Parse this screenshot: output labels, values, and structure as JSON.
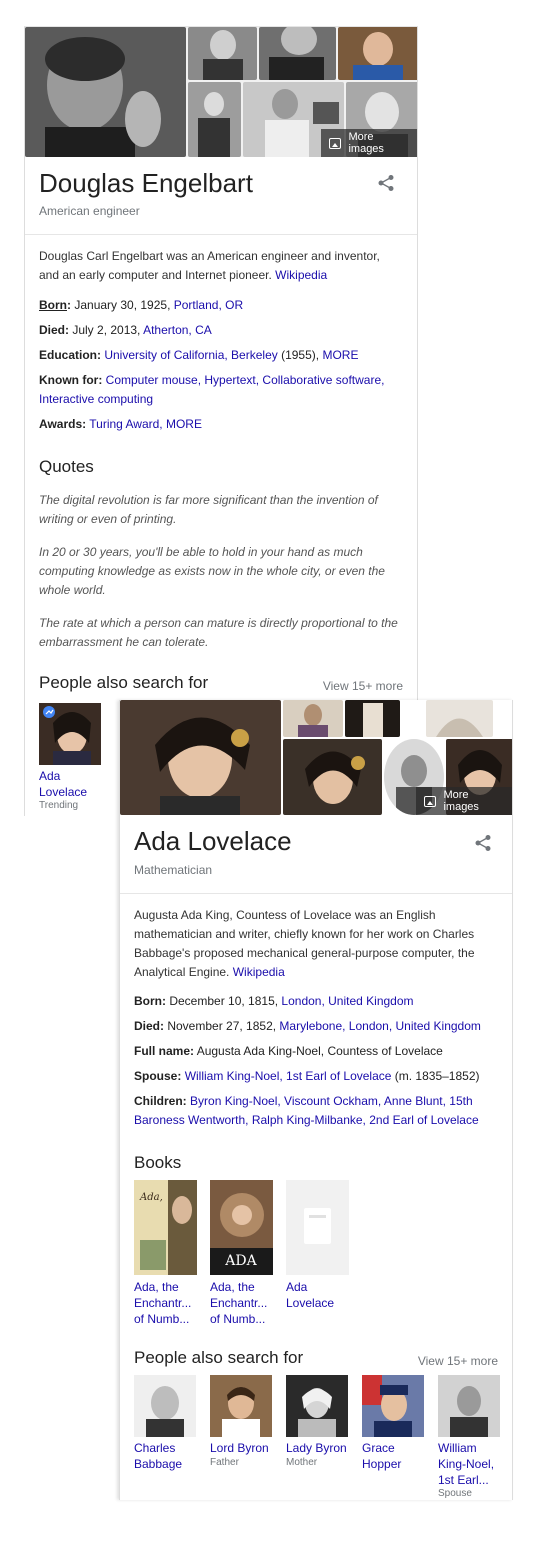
{
  "card1": {
    "more_images": "More images",
    "title": "Douglas Engelbart",
    "subtitle": "American engineer",
    "description": "Douglas Carl Engelbart was an American engineer and inventor, and an early computer and Internet pioneer.",
    "wiki": "Wikipedia",
    "born": {
      "label": "Born",
      "text": "January 30, 1925, ",
      "link": "Portland, OR"
    },
    "died": {
      "label": "Died:",
      "text": "July 2, 2013, ",
      "link": "Atherton, CA"
    },
    "education": {
      "label": "Education:",
      "link1": "University of California, Berkeley",
      "text": " (1955), ",
      "link2": "MORE"
    },
    "known_for": {
      "label": "Known for:",
      "links": "Computer mouse, Hypertext, Collaborative software, Interactive computing"
    },
    "awards": {
      "label": "Awards:",
      "links": "Turing Award, MORE"
    },
    "quotes_heading": "Quotes",
    "quotes": [
      "The digital revolution is far more significant than the invention of writing or even of printing.",
      "In 20 or 30 years, you'll be able to hold in your hand as much computing knowledge as exists now in the whole city, or even the whole world.",
      "The rate at which a person can mature is directly proportional to the embarrassment he can tolerate."
    ],
    "people_heading": "People also search for",
    "view_more": "View 15+ more",
    "people": [
      {
        "name": "Ada Lovelace",
        "sub": "Trending"
      }
    ]
  },
  "card2": {
    "more_images": "More images",
    "title": "Ada Lovelace",
    "subtitle": "Mathematician",
    "description": "Augusta Ada King, Countess of Lovelace was an English mathematician and writer, chiefly known for her work on Charles Babbage's proposed mechanical general-purpose computer, the Analytical Engine.",
    "wiki": "Wikipedia",
    "born": {
      "label": "Born:",
      "text": "December 10, 1815, ",
      "link": "London, United Kingdom"
    },
    "died": {
      "label": "Died:",
      "text": "November 27, 1852, ",
      "link": "Marylebone, London, United Kingdom"
    },
    "full_name": {
      "label": "Full name:",
      "text": "Augusta Ada King-Noel, Countess of Lovelace"
    },
    "spouse": {
      "label": "Spouse:",
      "link": "William King-Noel, 1st Earl of Lovelace",
      "text": " (m. 1835–1852)"
    },
    "children": {
      "label": "Children:",
      "links": "Byron King-Noel, Viscount Ockham, Anne Blunt, 15th Baroness Wentworth, Ralph King-Milbanke, 2nd Earl of Lovelace"
    },
    "books_heading": "Books",
    "books": [
      {
        "title": "Ada, the Enchantr... of Numb..."
      },
      {
        "title": "Ada, the Enchantr... of Numb...",
        "cover_text": "ADA"
      },
      {
        "title": "Ada Lovelace"
      }
    ],
    "people_heading": "People also search for",
    "view_more": "View 15+ more",
    "people": [
      {
        "name": "Charles Babbage",
        "sub": ""
      },
      {
        "name": "Lord Byron",
        "sub": "Father"
      },
      {
        "name": "Lady Byron",
        "sub": "Mother"
      },
      {
        "name": "Grace Hopper",
        "sub": ""
      },
      {
        "name": "William King-Noel, 1st Earl...",
        "sub": "Spouse"
      }
    ]
  }
}
